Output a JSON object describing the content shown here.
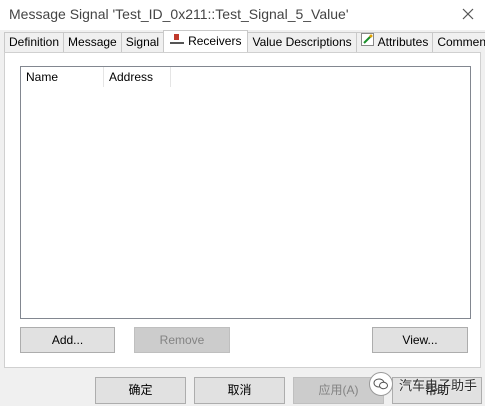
{
  "window": {
    "title": "Message Signal 'Test_ID_0x211::Test_Signal_5_Value'"
  },
  "tabs": [
    {
      "label": "Definition",
      "icon": null
    },
    {
      "label": "Message",
      "icon": null
    },
    {
      "label": "Signal",
      "icon": null
    },
    {
      "label": "Receivers",
      "icon": "receivers-icon"
    },
    {
      "label": "Value Descriptions",
      "icon": null
    },
    {
      "label": "Attributes",
      "icon": "attributes-icon"
    },
    {
      "label": "Comment",
      "icon": null
    }
  ],
  "active_tab": "Receivers",
  "receivers_list": {
    "columns": [
      "Name",
      "Address"
    ],
    "rows": []
  },
  "panel_buttons": {
    "add": "Add...",
    "remove": "Remove",
    "view": "View..."
  },
  "footer_buttons": {
    "ok": "确定",
    "cancel": "取消",
    "apply": "应用(A)",
    "help": "帮助"
  },
  "watermark": {
    "text": "汽车电子助手"
  },
  "colors": {
    "dialog_bg": "#f0f0f0",
    "button_bg": "#e1e1e1",
    "disabled_button_bg": "#cccccc",
    "list_border": "#828790"
  }
}
